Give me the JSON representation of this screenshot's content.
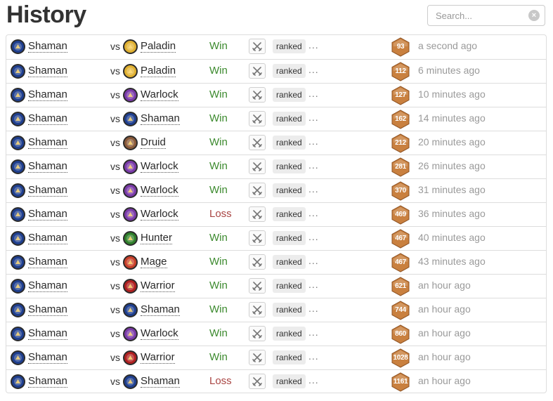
{
  "page": {
    "title": "History"
  },
  "search": {
    "placeholder": "Search...",
    "clear_icon": "clear-icon"
  },
  "player_class": "Shaman",
  "vs_label": "vs",
  "mode_label": "ranked",
  "more_label": "...",
  "mode_icon": "crossed-swords-icon",
  "class_colors": {
    "Shaman": "#1f3f8f",
    "Paladin": "#e0b030",
    "Warlock": "#7a3aa8",
    "Druid": "#8a5a3a",
    "Hunter": "#2f7f2a",
    "Mage": "#c8402a",
    "Warrior": "#b02020"
  },
  "result_colors": {
    "Win": "#3c8a2e",
    "Loss": "#a94442"
  },
  "rank_color": "#c9803f",
  "games": [
    {
      "player": "Shaman",
      "opponent": "Paladin",
      "result": "Win",
      "mode": "ranked",
      "rank": "93",
      "time": "a second ago"
    },
    {
      "player": "Shaman",
      "opponent": "Paladin",
      "result": "Win",
      "mode": "ranked",
      "rank": "112",
      "time": "6 minutes ago"
    },
    {
      "player": "Shaman",
      "opponent": "Warlock",
      "result": "Win",
      "mode": "ranked",
      "rank": "127",
      "time": "10 minutes ago"
    },
    {
      "player": "Shaman",
      "opponent": "Shaman",
      "result": "Win",
      "mode": "ranked",
      "rank": "162",
      "time": "14 minutes ago"
    },
    {
      "player": "Shaman",
      "opponent": "Druid",
      "result": "Win",
      "mode": "ranked",
      "rank": "212",
      "time": "20 minutes ago"
    },
    {
      "player": "Shaman",
      "opponent": "Warlock",
      "result": "Win",
      "mode": "ranked",
      "rank": "281",
      "time": "26 minutes ago"
    },
    {
      "player": "Shaman",
      "opponent": "Warlock",
      "result": "Win",
      "mode": "ranked",
      "rank": "370",
      "time": "31 minutes ago"
    },
    {
      "player": "Shaman",
      "opponent": "Warlock",
      "result": "Loss",
      "mode": "ranked",
      "rank": "469",
      "time": "36 minutes ago"
    },
    {
      "player": "Shaman",
      "opponent": "Hunter",
      "result": "Win",
      "mode": "ranked",
      "rank": "467",
      "time": "40 minutes ago"
    },
    {
      "player": "Shaman",
      "opponent": "Mage",
      "result": "Win",
      "mode": "ranked",
      "rank": "467",
      "time": "43 minutes ago"
    },
    {
      "player": "Shaman",
      "opponent": "Warrior",
      "result": "Win",
      "mode": "ranked",
      "rank": "621",
      "time": "an hour ago"
    },
    {
      "player": "Shaman",
      "opponent": "Shaman",
      "result": "Win",
      "mode": "ranked",
      "rank": "744",
      "time": "an hour ago"
    },
    {
      "player": "Shaman",
      "opponent": "Warlock",
      "result": "Win",
      "mode": "ranked",
      "rank": "860",
      "time": "an hour ago"
    },
    {
      "player": "Shaman",
      "opponent": "Warrior",
      "result": "Win",
      "mode": "ranked",
      "rank": "1028",
      "time": "an hour ago"
    },
    {
      "player": "Shaman",
      "opponent": "Shaman",
      "result": "Loss",
      "mode": "ranked",
      "rank": "1161",
      "time": "an hour ago"
    }
  ]
}
